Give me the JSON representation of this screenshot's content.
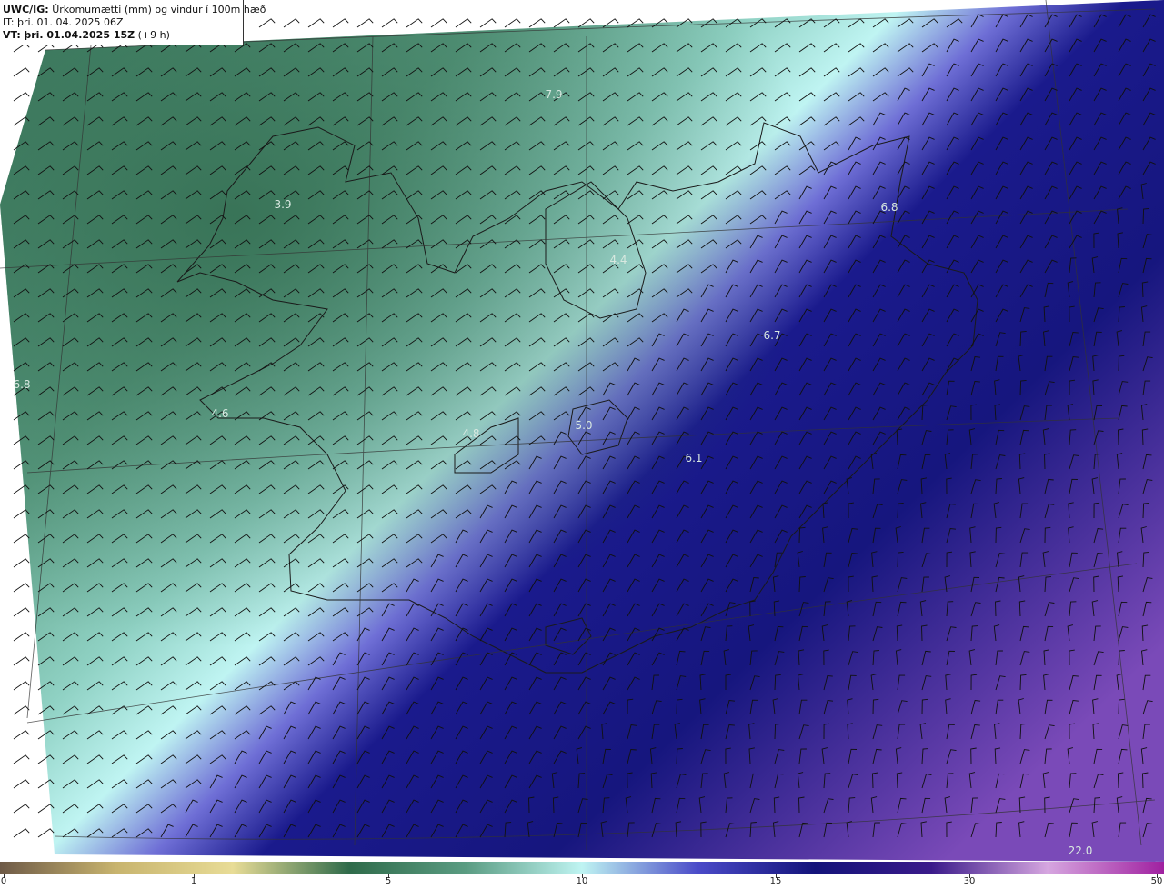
{
  "header": {
    "model": "UWC/IG:",
    "title": "Úrkomumætti (mm) og vindur í 100m hæð",
    "it_line": "IT: þri. 01. 04. 2025 06Z",
    "vt_label": "VT:",
    "vt_value": "þri. 01.04.2025 15Z",
    "vt_offset": "(+9 h)"
  },
  "map_labels": [
    "7.9",
    "3.9",
    "6.8",
    "4.4",
    "6.7",
    "6.8",
    "4.6",
    "4.8",
    "5.0",
    "6.1",
    "22.0"
  ],
  "colorbar": {
    "ticks": [
      "0",
      "1",
      "5",
      "10",
      "15",
      "30",
      "50"
    ],
    "stops": [
      "#6e5a47",
      "#c8b46e",
      "#e8dc96",
      "#2f6b4a",
      "#5a9c82",
      "#bff4f2",
      "#4a4ac8",
      "#13137a",
      "#3a1a8a",
      "#d6a6e0",
      "#a020a0"
    ]
  },
  "colors": {
    "land_green": "#3f7f61",
    "sea_teal": "#7cc4b0",
    "ice_cyan": "#bff4f2",
    "deep_blue": "#1a1a8c",
    "purple": "#7a4ab8"
  }
}
